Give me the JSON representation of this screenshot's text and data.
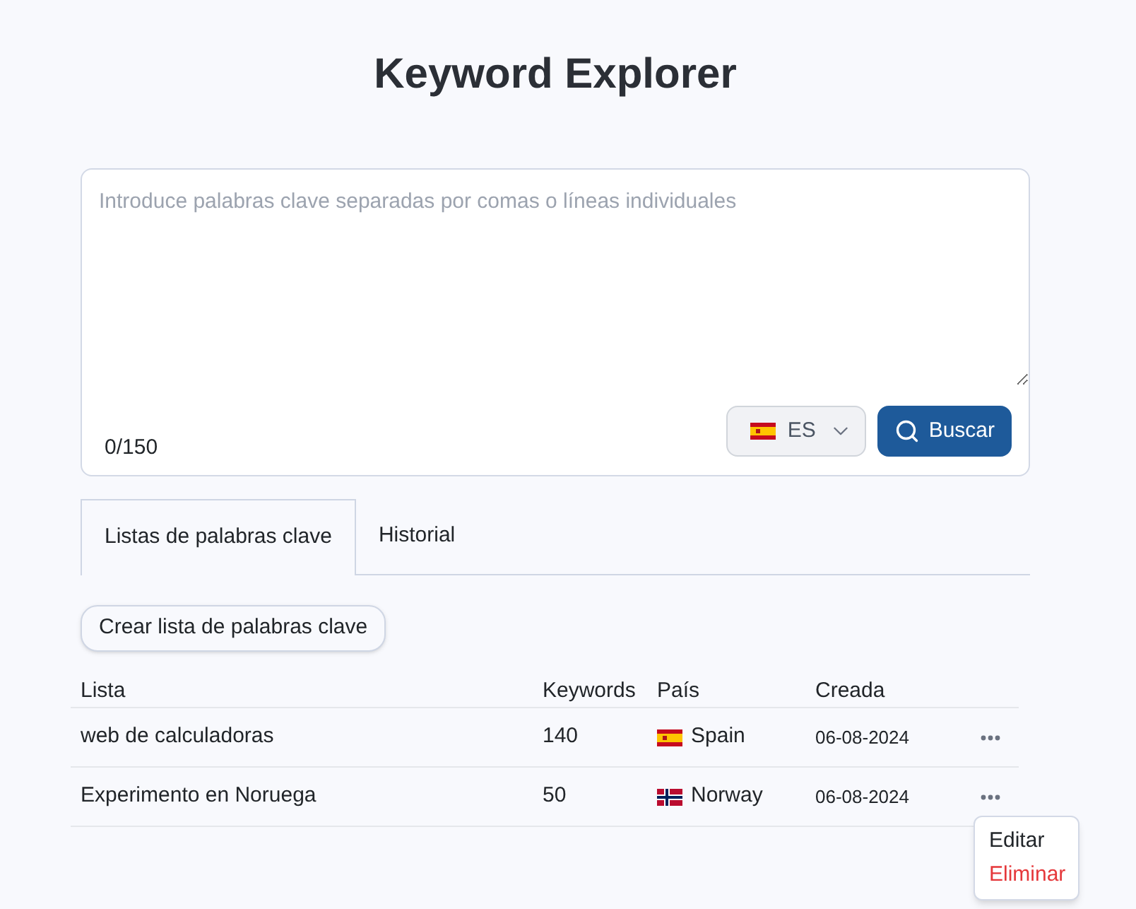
{
  "page": {
    "title": "Keyword Explorer"
  },
  "search": {
    "placeholder": "Introduce palabras clave separadas por comas o líneas individuales",
    "counter": "0/150",
    "language": {
      "code": "ES",
      "flag": {
        "kind": "spain"
      }
    },
    "submit": "Buscar"
  },
  "tabs": [
    {
      "label": "Listas de palabras clave",
      "selected": true
    },
    {
      "label": "Historial",
      "selected": false
    }
  ],
  "create_button": "Crear lista de palabras clave",
  "table": {
    "columns": [
      "Lista",
      "Keywords",
      "País",
      "Creada"
    ],
    "rows": [
      {
        "name": "web de calculadoras",
        "keywords": "140",
        "country": "Spain",
        "flag": {
          "kind": "spain"
        },
        "created": "06-08-2024",
        "menu_open": false
      },
      {
        "name": "Experimento en Noruega",
        "keywords": "50",
        "country": "Norway",
        "flag": {
          "kind": "norway"
        },
        "created": "06-08-2024",
        "menu_open": true
      }
    ]
  },
  "row_menu": {
    "items": [
      {
        "label": "Editar",
        "kind": "normal"
      },
      {
        "label": "Eliminar",
        "kind": "danger"
      }
    ]
  }
}
